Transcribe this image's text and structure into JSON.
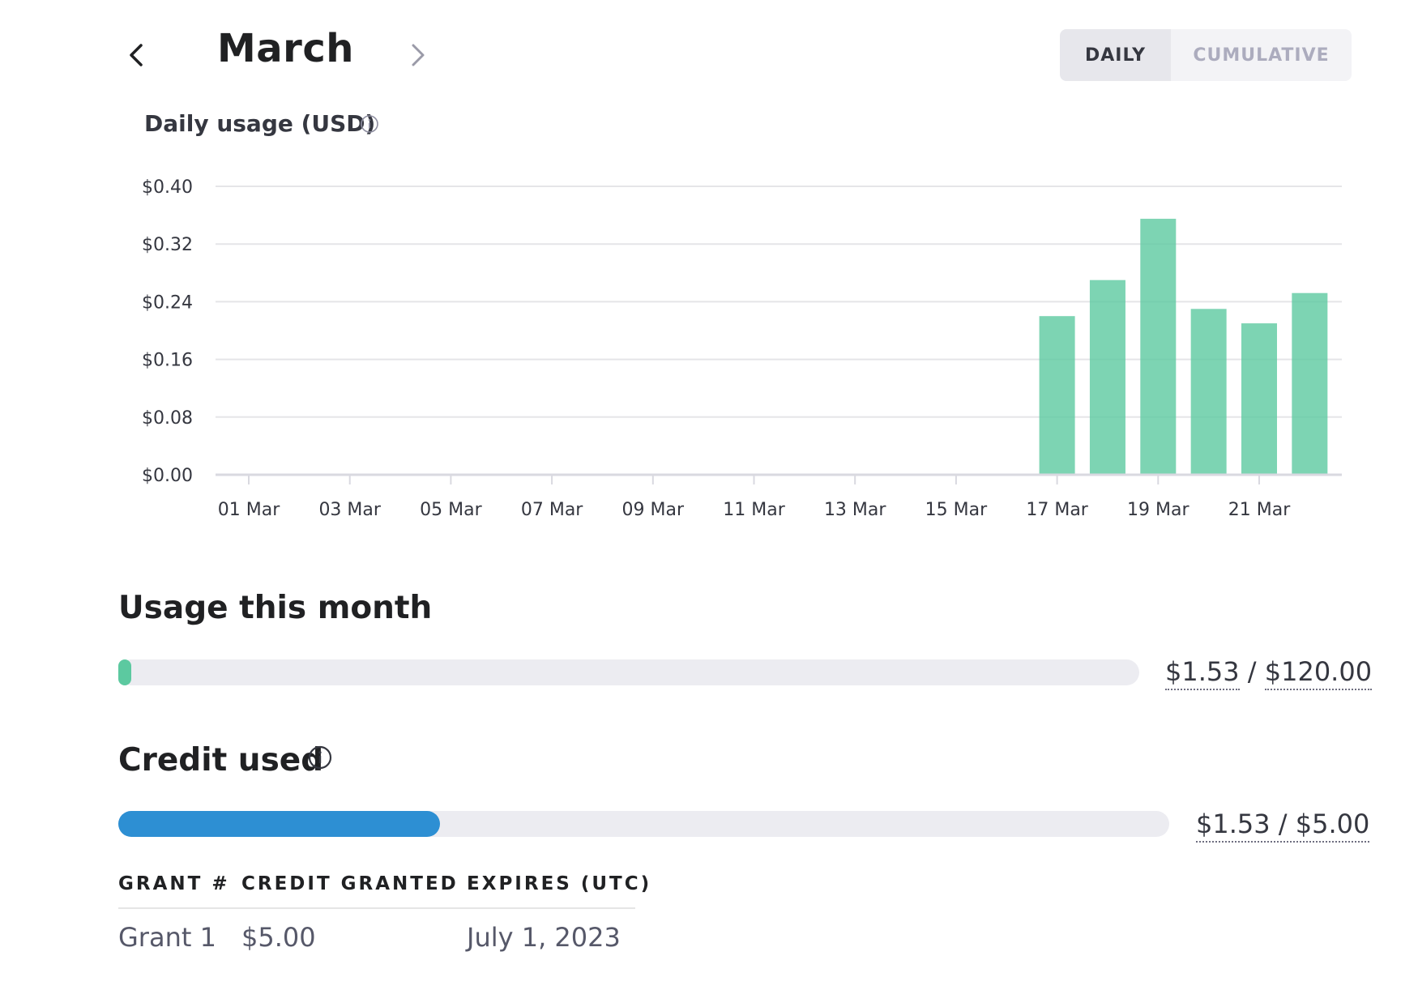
{
  "header": {
    "month": "March",
    "toggle": {
      "daily": "DAILY",
      "cumulative": "CUMULATIVE",
      "selected": "DAILY"
    }
  },
  "chart": {
    "title": "Daily usage (USD)"
  },
  "chart_data": {
    "type": "bar",
    "title": "Daily usage (USD)",
    "xlabel": "",
    "ylabel": "",
    "ylim": [
      0,
      0.4
    ],
    "y_ticks": [
      "$0.40",
      "$0.32",
      "$0.24",
      "$0.16",
      "$0.08",
      "$0.00"
    ],
    "y_tick_values": [
      0.4,
      0.32,
      0.24,
      0.16,
      0.08,
      0.0
    ],
    "x_tick_labels": [
      "01 Mar",
      "03 Mar",
      "05 Mar",
      "07 Mar",
      "09 Mar",
      "11 Mar",
      "13 Mar",
      "15 Mar",
      "17 Mar",
      "19 Mar",
      "21 Mar"
    ],
    "categories": [
      "01 Mar",
      "02 Mar",
      "03 Mar",
      "04 Mar",
      "05 Mar",
      "06 Mar",
      "07 Mar",
      "08 Mar",
      "09 Mar",
      "10 Mar",
      "11 Mar",
      "12 Mar",
      "13 Mar",
      "14 Mar",
      "15 Mar",
      "16 Mar",
      "17 Mar",
      "18 Mar",
      "19 Mar",
      "20 Mar",
      "21 Mar",
      "22 Mar"
    ],
    "values": [
      0,
      0,
      0,
      0,
      0,
      0,
      0,
      0,
      0,
      0,
      0,
      0,
      0,
      0,
      0,
      0,
      0.22,
      0.27,
      0.355,
      0.23,
      0.21,
      0.252
    ],
    "bar_color": "#5cc9a0",
    "grid": true
  },
  "usage": {
    "title": "Usage this month",
    "used": "$1.53",
    "separator": "/",
    "limit": "$120.00",
    "fraction": 0.0128,
    "color": "#5cc9a0"
  },
  "credit": {
    "title": "Credit used",
    "used": "$1.53",
    "separator": "/",
    "total": "$5.00",
    "fraction": 0.306,
    "color": "#2d8fd3"
  },
  "grants": {
    "headers": [
      "GRANT #",
      "CREDIT GRANTED",
      "EXPIRES (UTC)"
    ],
    "rows": [
      [
        "Grant 1",
        "$5.00",
        "July 1, 2023"
      ]
    ]
  }
}
